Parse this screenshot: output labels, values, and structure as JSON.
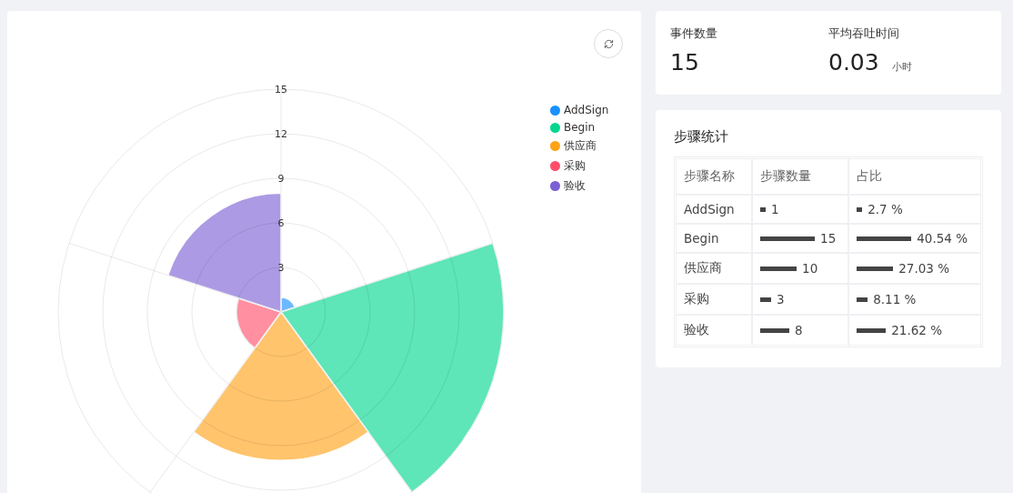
{
  "chart_panel": {
    "radial_ticks": [
      "15",
      "12",
      "9",
      "6",
      "3"
    ],
    "legend": [
      {
        "label": "AddSign",
        "color": "#1890ff"
      },
      {
        "label": "Begin",
        "color": "#00d68f"
      },
      {
        "label": "供应商",
        "color": "#ffa216"
      },
      {
        "label": "采购",
        "color": "#ff4d6a"
      },
      {
        "label": "验收",
        "color": "#7b5fd4"
      }
    ]
  },
  "summary": [
    {
      "label": "事件数量",
      "value": "15"
    },
    {
      "label": "平均吞吐时间",
      "value": "0.03",
      "unit": "小时"
    }
  ],
  "step_stats": {
    "title": "步骤统计",
    "columns": [
      "步骤名称",
      "步骤数量",
      "占比"
    ],
    "rows": [
      {
        "name": "AddSign",
        "count": "1",
        "share": "2.7 %"
      },
      {
        "name": "Begin",
        "count": "15",
        "share": "40.54 %"
      },
      {
        "name": "供应商",
        "count": "10",
        "share": "27.03 %"
      },
      {
        "name": "采购",
        "count": "3",
        "share": "8.11 %"
      },
      {
        "name": "验收",
        "count": "8",
        "share": "21.62 %"
      }
    ]
  }
}
